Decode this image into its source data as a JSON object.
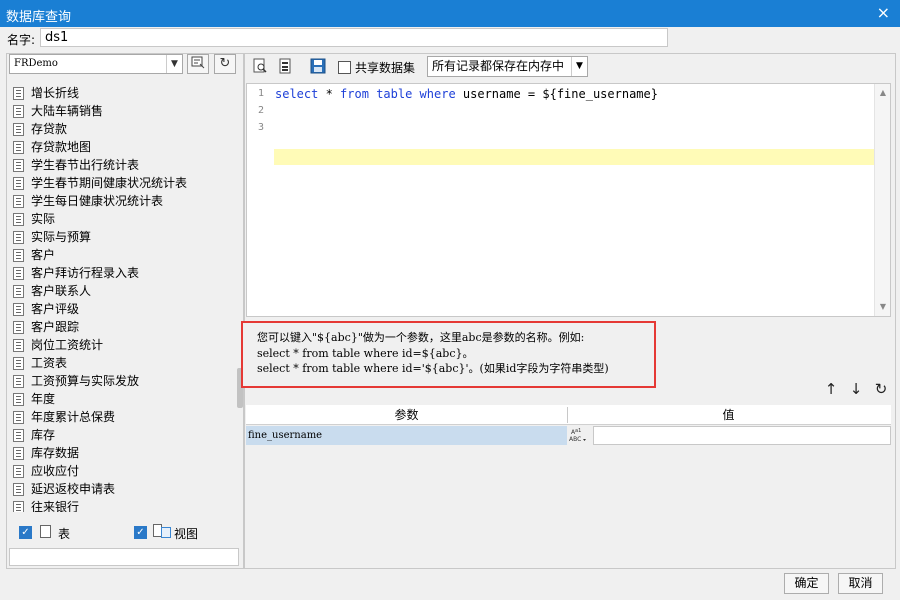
{
  "window": {
    "title": "数据库查询",
    "close_icon": "×"
  },
  "name_field": {
    "label": "名字:",
    "value": "ds1"
  },
  "left": {
    "datasource": "FRDemo",
    "table_items": [
      "增长折线",
      "大陆车辆销售",
      "存贷款",
      "存贷款地图",
      "学生春节出行统计表",
      "学生春节期间健康状况统计表",
      "学生每日健康状况统计表",
      "实际",
      "实际与预算",
      "客户",
      "客户拜访行程录入表",
      "客户联系人",
      "客户评级",
      "客户跟踪",
      "岗位工资统计",
      "工资表",
      "工资预算与实际发放",
      "年度",
      "年度累计总保费",
      "库存",
      "库存数据",
      "应收应付",
      "延迟返校申请表",
      "往来银行"
    ],
    "filter": {
      "table_label": "表",
      "view_label": "视图"
    }
  },
  "toolbar": {
    "share_label": "共享数据集",
    "memory_option": "所有记录都保存在内存中"
  },
  "editor": {
    "line_numbers": [
      "1",
      "2",
      "3"
    ],
    "line1": {
      "kw1": "select",
      "t1": " * ",
      "kw2": "from",
      "t2": " ",
      "kw3": "table",
      "t3": " ",
      "kw4": "where",
      "t4": " username = ${fine_username}"
    }
  },
  "hint": {
    "line1": "您可以键入\"${abc}\"做为一个参数，这里abc是参数的名称。例如:",
    "line2": "select * from table where id=${abc}。",
    "line3": "select * from table where id='${abc}'。(如果id字段为字符串类型)"
  },
  "params": {
    "header_name": "参数",
    "header_value": "值",
    "rows": [
      {
        "name": "fine_username",
        "type_icon": "abc-icon",
        "value": ""
      }
    ]
  },
  "footer": {
    "ok_label": "确定",
    "cancel_label": "取消"
  },
  "colors": {
    "titlebar": "#1a7fd4",
    "highlight_box": "#e53935",
    "keyword": "#1e40d8",
    "current_line": "#fffbb7"
  }
}
